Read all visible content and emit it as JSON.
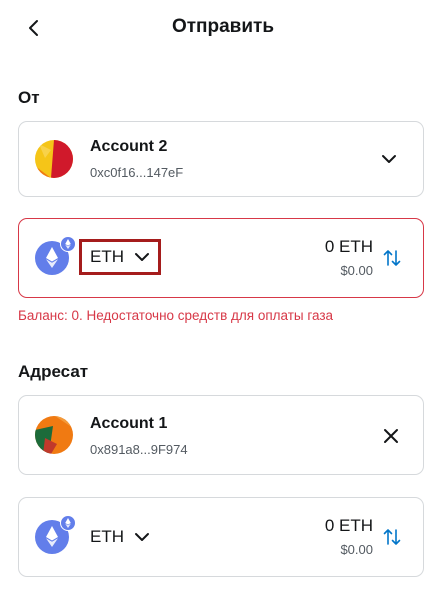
{
  "header": {
    "back_icon": "chevron-left-icon",
    "title": "Отправить"
  },
  "from": {
    "label": "От",
    "account": {
      "name": "Account 2",
      "address": "0xc0f16...147eF",
      "chevron_icon": "chevron-down-icon"
    },
    "asset": {
      "token_icon": "eth-icon",
      "symbol": "ETH",
      "chevron_icon": "chevron-down-icon",
      "amount": "0 ETH",
      "fiat": "$0.00",
      "swap_icon": "swap-vertical-icon"
    },
    "error": "Баланс: 0. Недостаточно средств для оплаты газа"
  },
  "to": {
    "label": "Адресат",
    "account": {
      "name": "Account 1",
      "address": "0x891a8...9F974",
      "close_icon": "close-icon"
    },
    "asset": {
      "token_icon": "eth-icon",
      "symbol": "ETH",
      "chevron_icon": "chevron-down-icon",
      "amount": "0 ETH",
      "fiat": "$0.00",
      "swap_icon": "swap-vertical-icon"
    }
  },
  "colors": {
    "error": "#d73847",
    "highlight_box": "#a51c1c",
    "eth_blue": "#627eea",
    "swap_blue": "#0376c9"
  }
}
